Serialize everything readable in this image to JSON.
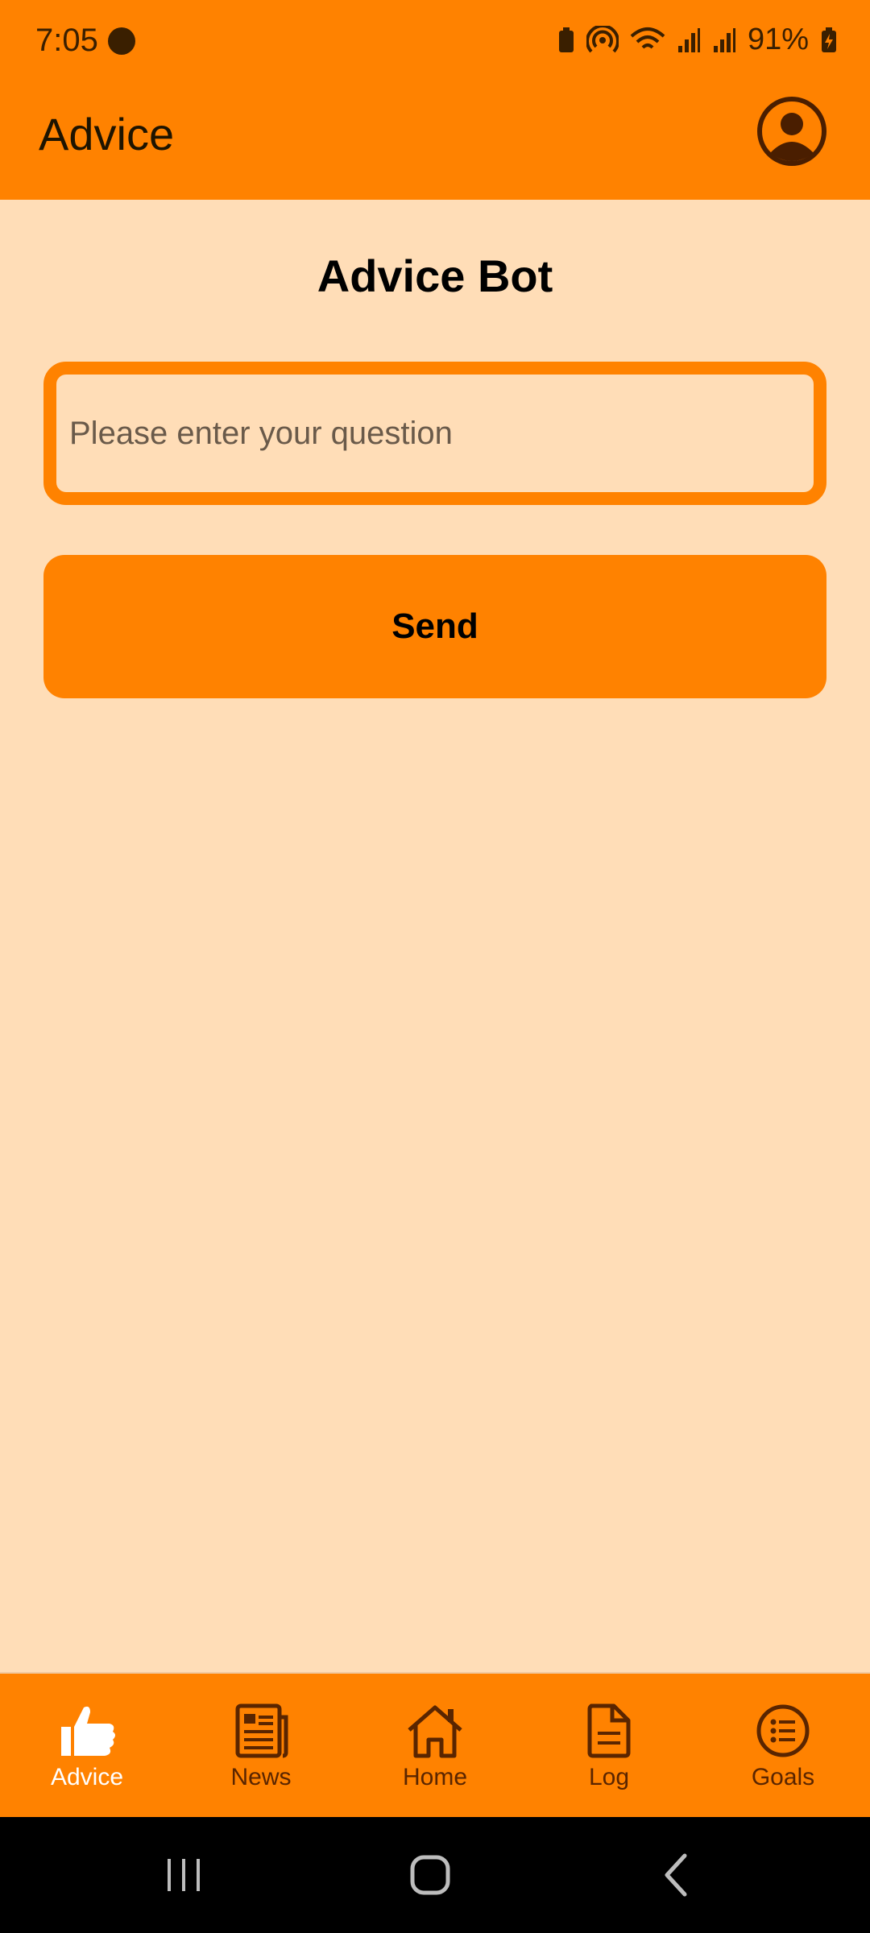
{
  "status_bar": {
    "time": "7:05",
    "battery_percent": "91%",
    "icons": [
      "profile-icon",
      "battery-saver-icon",
      "hotspot-icon",
      "wifi-icon",
      "signal-icon",
      "signal-icon",
      "battery-charging-icon"
    ]
  },
  "app_bar": {
    "title": "Advice",
    "profile_icon": "account-circle-icon"
  },
  "main": {
    "title": "Advice Bot",
    "question_input": {
      "placeholder": "Please enter your question",
      "value": ""
    },
    "send_label": "Send"
  },
  "bottom_nav": {
    "items": [
      {
        "label": "Advice",
        "icon": "thumbs-up-icon",
        "active": true
      },
      {
        "label": "News",
        "icon": "newspaper-icon",
        "active": false
      },
      {
        "label": "Home",
        "icon": "home-icon",
        "active": false
      },
      {
        "label": "Log",
        "icon": "document-icon",
        "active": false
      },
      {
        "label": "Goals",
        "icon": "list-circle-icon",
        "active": false
      }
    ]
  },
  "colors": {
    "primary": "#FF8200",
    "background": "#FFDDB7",
    "nav_active": "#FFFFFF",
    "nav_inactive": "#5A2500"
  }
}
